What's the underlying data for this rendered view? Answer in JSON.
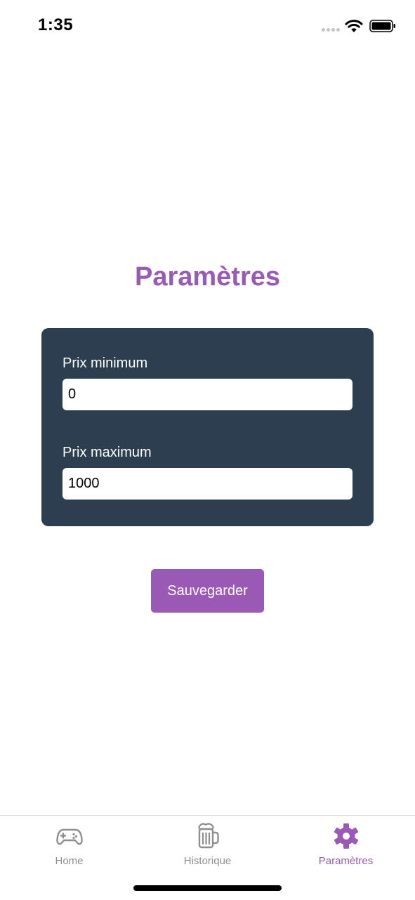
{
  "status_bar": {
    "time": "1:35"
  },
  "page": {
    "title": "Paramètres"
  },
  "form": {
    "min_price_label": "Prix minimum",
    "min_price_value": "0",
    "max_price_label": "Prix maximum",
    "max_price_value": "1000"
  },
  "actions": {
    "save_label": "Sauvegarder"
  },
  "tabs": [
    {
      "label": "Home",
      "icon": "gamepad-icon",
      "active": false
    },
    {
      "label": "Historique",
      "icon": "beer-mug-icon",
      "active": false
    },
    {
      "label": "Paramètres",
      "icon": "gear-icon",
      "active": true
    }
  ],
  "colors": {
    "accent": "#9b59b6",
    "card_background": "#2c3e50",
    "inactive_tab": "#8e8e93"
  }
}
